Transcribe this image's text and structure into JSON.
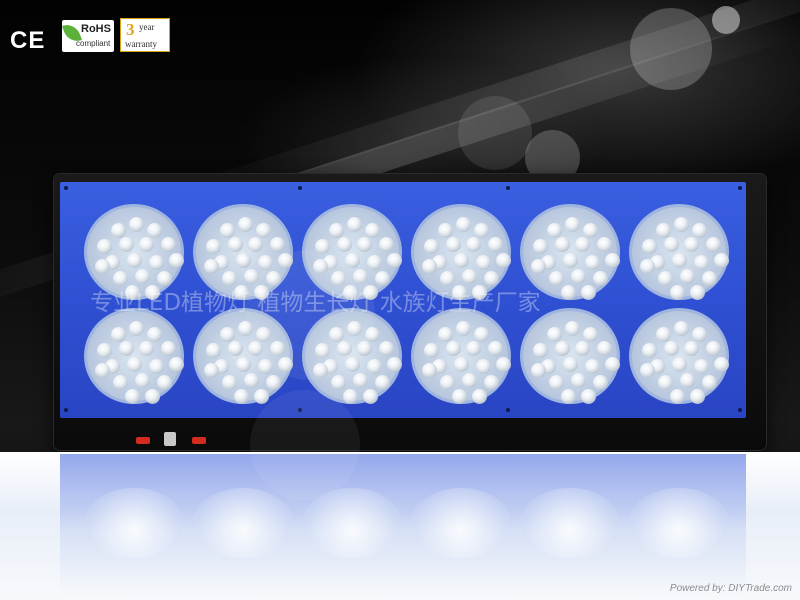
{
  "certifications": {
    "ce": "CE",
    "rohs": {
      "label": "RoHS",
      "sub": "compliant",
      "icon": "leaf-icon"
    },
    "warranty": {
      "number": "3",
      "unit": "year",
      "label": "warranty"
    }
  },
  "watermark": "专业LED植物灯 植物生长灯 水族灯生产厂家",
  "credit": "Powered by: DIYTrade.com",
  "panel": {
    "rows": 2,
    "modules_per_row": 6,
    "face_color": "#3354d8",
    "switch_color": "#d22b20"
  }
}
